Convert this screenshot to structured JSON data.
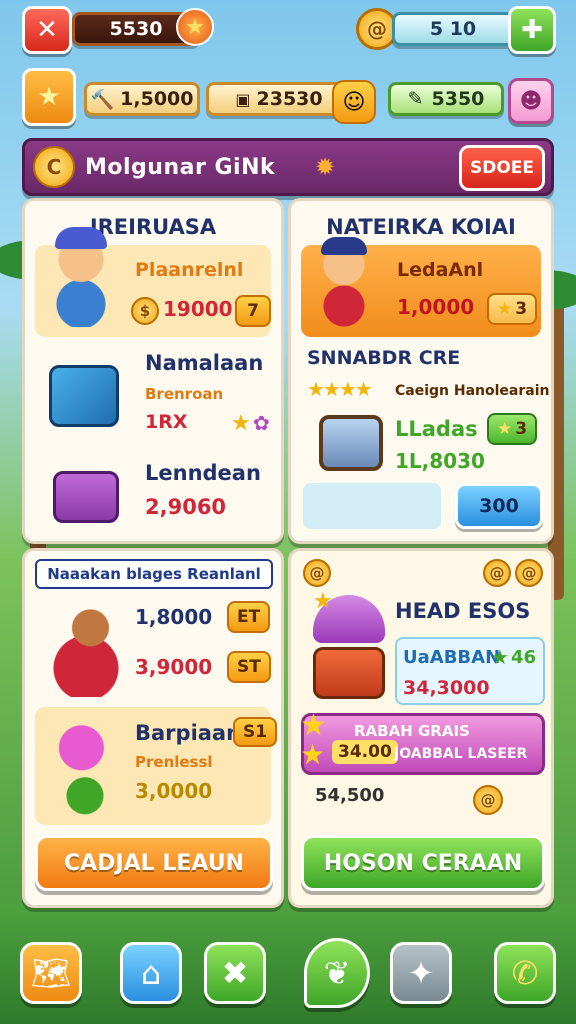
{
  "top_bar": {
    "close_icon": "close-icon",
    "currency_1": "5530",
    "currency_2": "5 10"
  },
  "resources": {
    "star_icon": "star-icon",
    "res_1": "1,5000",
    "res_2": "23530",
    "res_3": "5350"
  },
  "banner": {
    "title": "Molgunar GiNk",
    "shop_label": "SDOEE"
  },
  "panel_a": {
    "title": "IREIRUASA",
    "item1": {
      "name": "Plaanrelnl",
      "price": "190001",
      "badge": "7"
    },
    "item2": {
      "name": "Namalaan",
      "sub": "Brenroan",
      "value": "1RX"
    },
    "item3": {
      "name": "Lenndean",
      "value": "2,9060"
    }
  },
  "panel_b": {
    "title": "NATEIRKA KOIAI",
    "item1": {
      "name": "LedaAnl",
      "value": "1,0000",
      "badge": "3"
    },
    "section": "SNNABDR CRE",
    "stars_label": "Caeign Hanolearain",
    "item2": {
      "name": "LLadas",
      "value": "1L,8030",
      "badge": "3"
    },
    "button": "300"
  },
  "panel_c": {
    "title": "Naaakan blages Reanlanl",
    "item1": {
      "value": "1,8000",
      "badge": "ET"
    },
    "item2": {
      "value": "3,9000",
      "badge": "ST"
    },
    "item3": {
      "name": "Barpiaan",
      "badge": "S1",
      "sub": "Prenlessl",
      "value": "3,0000"
    },
    "button": "CADJAL LEAUN"
  },
  "panel_d": {
    "title": "HEAD ESOS",
    "item1": {
      "name": "UaABBAN",
      "badge": "46",
      "value": "34,3000"
    },
    "promo_line1": "RABAH GRAIS",
    "promo_price": "34.00",
    "promo_line2": "JOABBAL LASEER",
    "value": "54,500",
    "button": "HOSON CERAAN"
  },
  "nav": [
    "map-icon",
    "home-icon",
    "tools-icon",
    "leaf-icon",
    "character-icon",
    "phone-icon"
  ],
  "colors": {
    "accent": "#8a3a86",
    "panel": "#fffaf0",
    "price_red": "#d0263a"
  }
}
